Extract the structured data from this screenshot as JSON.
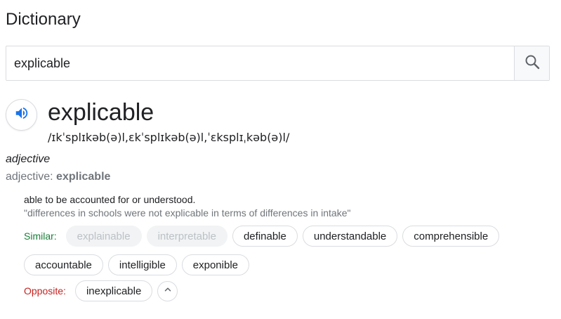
{
  "header": {
    "title": "Dictionary"
  },
  "search": {
    "value": "explicable",
    "icon": "search-icon"
  },
  "entry": {
    "audio_icon": "speaker-icon",
    "word": "explicable",
    "phonetic": "/ɪkˈsplɪkəb(ə)l,ɛkˈsplɪkəb(ə)l,ˈɛksplɪˌkəb(ə)l/",
    "part_of_speech": "adjective",
    "form_prefix": "adjective: ",
    "form_word": "explicable"
  },
  "sense": {
    "definition": "able to be accounted for or understood.",
    "example": "\"differences in schools were not explicable in terms of differences in intake\""
  },
  "similar": {
    "label": "Similar:",
    "row1": [
      {
        "text": "explainable",
        "disabled": true
      },
      {
        "text": "interpretable",
        "disabled": true
      },
      {
        "text": "definable",
        "disabled": false
      },
      {
        "text": "understandable",
        "disabled": false
      },
      {
        "text": "comprehensible",
        "disabled": false
      }
    ],
    "row2": [
      {
        "text": "accountable",
        "disabled": false
      },
      {
        "text": "intelligible",
        "disabled": false
      },
      {
        "text": "exponible",
        "disabled": false
      }
    ]
  },
  "opposite": {
    "label": "Opposite:",
    "chips": [
      {
        "text": "inexplicable",
        "disabled": false
      }
    ],
    "collapse_icon": "chevron-up-icon"
  },
  "colors": {
    "similar_label": "#188038",
    "opposite_label": "#c5221f",
    "audio_icon": "#1a73e8",
    "muted": "#70757a"
  }
}
